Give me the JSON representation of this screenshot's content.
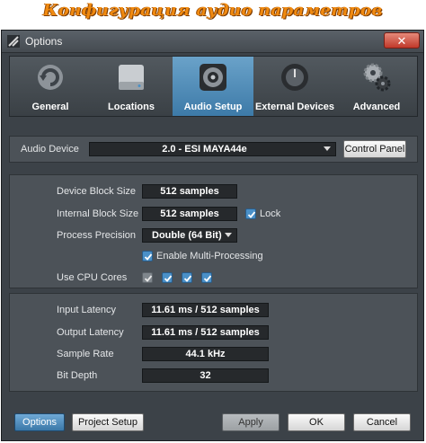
{
  "caption": "Конфигурация аудио параметров",
  "window": {
    "title": "Options",
    "close_glyph": "✕"
  },
  "tabs": [
    {
      "label": "General",
      "icon": "refresh-icon"
    },
    {
      "label": "Locations",
      "icon": "drive-icon"
    },
    {
      "label": "Audio Setup",
      "icon": "speaker-icon",
      "active": true
    },
    {
      "label": "External Devices",
      "icon": "knob-icon"
    },
    {
      "label": "Advanced",
      "icon": "gears-icon"
    }
  ],
  "device": {
    "label": "Audio Device",
    "value": "2.0 - ESI MAYA44e",
    "control_panel": "Control Panel"
  },
  "processing": {
    "block_size_label": "Device Block Size",
    "block_size_value": "512 samples",
    "internal_label": "Internal Block Size",
    "internal_value": "512 samples",
    "lock_label": "Lock",
    "lock_checked": true,
    "precision_label": "Process Precision",
    "precision_value": "Double (64 Bit)",
    "multi_label": "Enable Multi-Processing",
    "multi_checked": true,
    "cpu_label": "Use CPU Cores",
    "cpu_cores": [
      true,
      true,
      true,
      true
    ]
  },
  "info": {
    "input_latency_label": "Input Latency",
    "input_latency_value": "11.61 ms / 512 samples",
    "output_latency_label": "Output Latency",
    "output_latency_value": "11.61 ms / 512 samples",
    "sample_rate_label": "Sample Rate",
    "sample_rate_value": "44.1 kHz",
    "bit_depth_label": "Bit Depth",
    "bit_depth_value": "32"
  },
  "footer": {
    "options": "Options",
    "project_setup": "Project Setup",
    "apply": "Apply",
    "ok": "OK",
    "cancel": "Cancel"
  },
  "colors": {
    "accent": "#3d7aa8",
    "window_bg": "#3c4248",
    "caption": "#f08a10",
    "close": "#c0392b"
  }
}
